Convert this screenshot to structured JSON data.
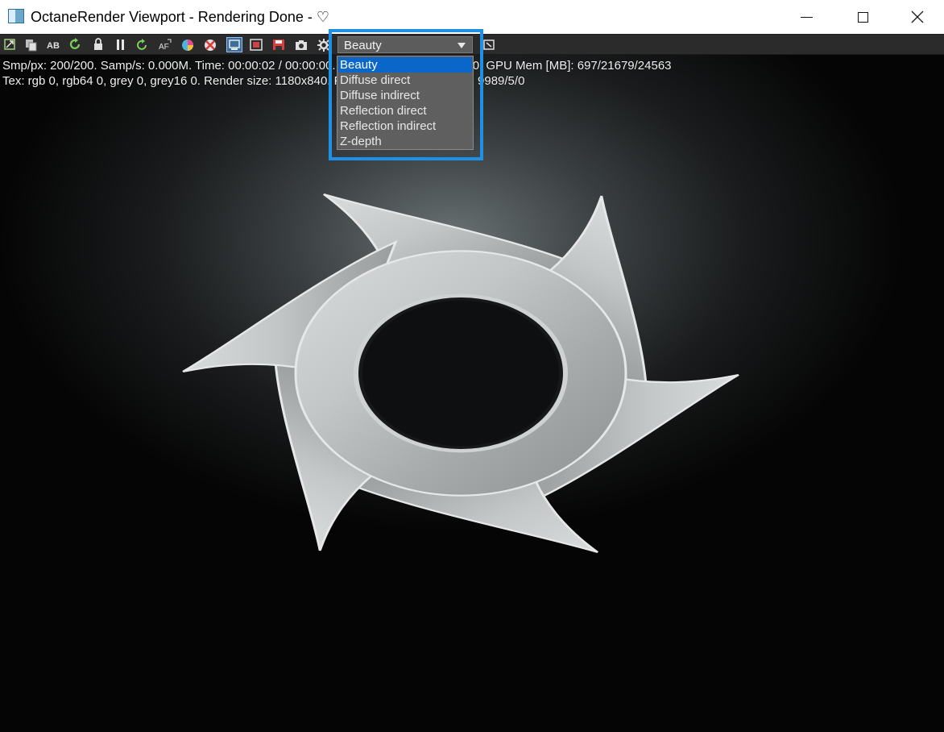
{
  "window": {
    "title": "OctaneRender Viewport - Rendering Done - ♡",
    "min_glyph": "",
    "close_glyph": "✕"
  },
  "toolbar": {
    "icons": [
      "recenter-icon",
      "copy-icon",
      "ab-compare-icon",
      "restart-icon",
      "lock-icon",
      "pause-icon",
      "reset-icon",
      "af-icon",
      "color-picker-icon",
      "clay-mode-icon",
      "region-render-icon",
      "film-region-icon",
      "save-icon",
      "camera-icon",
      "settings-icon"
    ],
    "ab_label": "AB",
    "af_label": "AF"
  },
  "status": {
    "line1": "Smp/px: 200/200.  Samp/s: 0.000M.  Time: 00:00:02 / 00:00:00.  Mesh: 00:00:02 / 00:00:00.  GPU Mem [MB]: 697/21679/24563",
    "line2": "Tex: rgb 0, rgb64 0, grey 0, grey16 0.  Render size: 1180x840.  Primitives/Meshes/Voxels: 9989/5/0"
  },
  "passes": {
    "selected": "Beauty",
    "options": [
      "Beauty",
      "Diffuse direct",
      "Diffuse indirect",
      "Reflection direct",
      "Reflection indirect",
      "Z-depth"
    ]
  },
  "colors": {
    "highlight": "#1e90e6",
    "selection": "#0a66c8"
  }
}
